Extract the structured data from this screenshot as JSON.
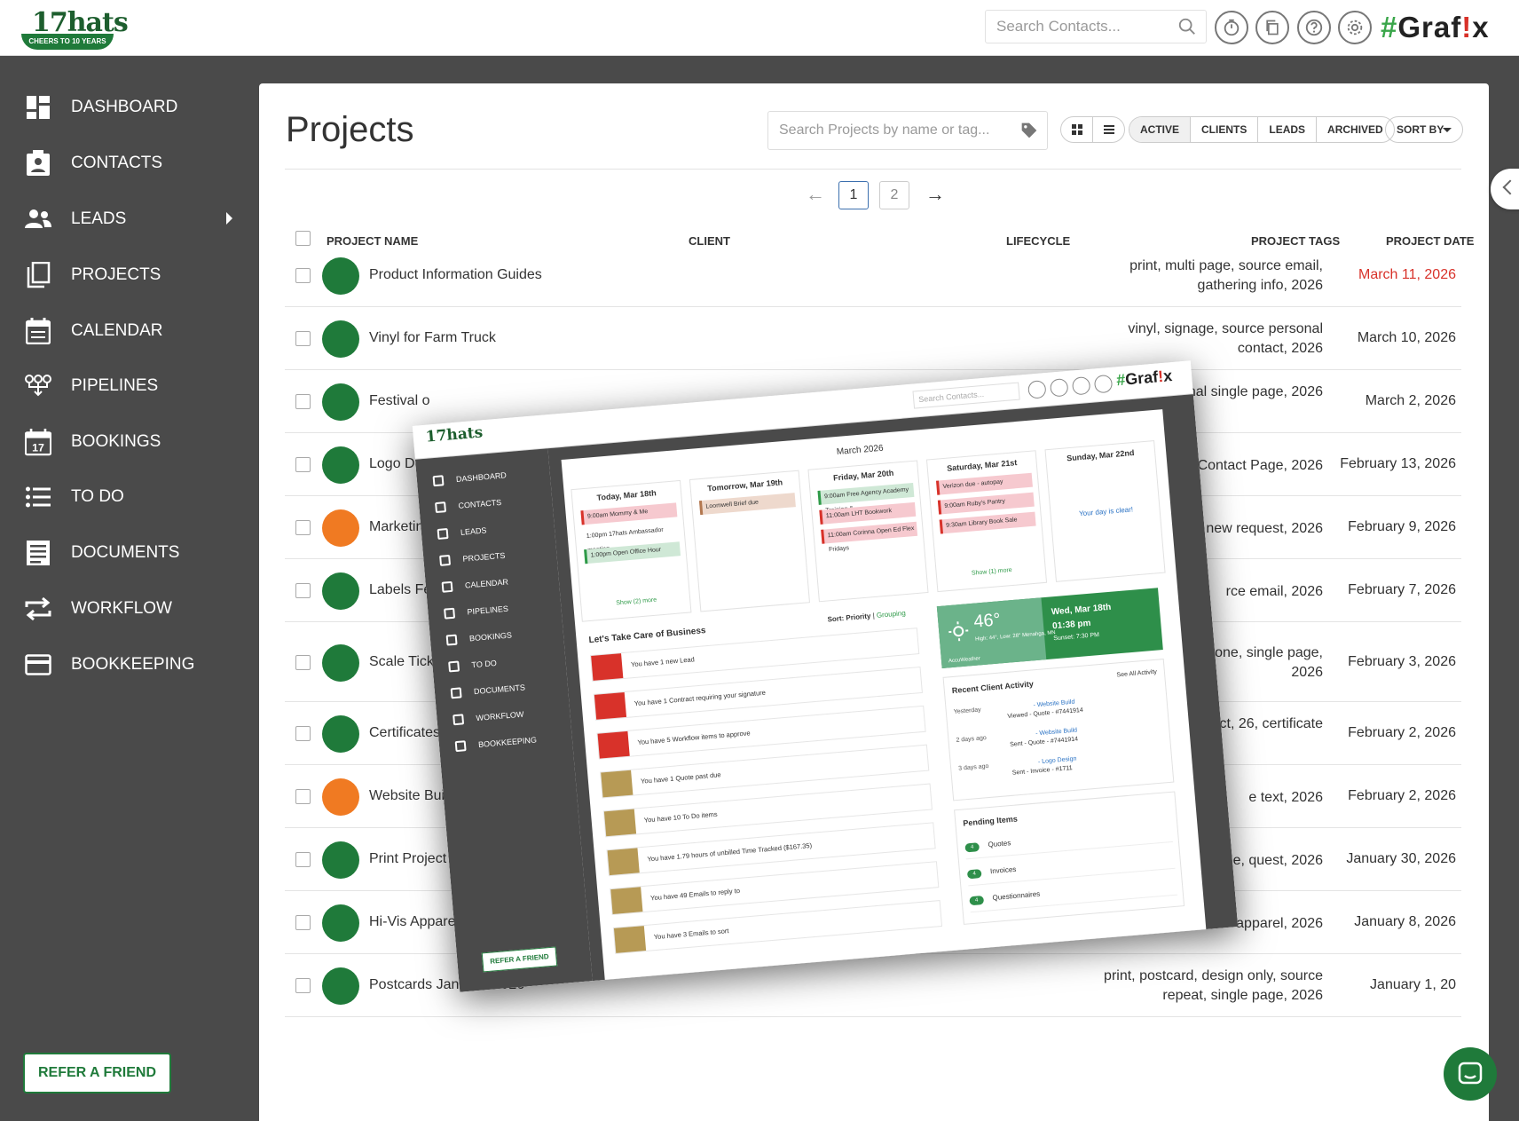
{
  "app": {
    "logo_text": "17hats",
    "logo_ribbon": "CHEERS TO 10 YEARS",
    "brand_hash": "#",
    "brand_a": "Graf",
    "brand_bang": "!",
    "brand_b": "x"
  },
  "topbar": {
    "search_placeholder": "Search Contacts..."
  },
  "sidebar": {
    "items": [
      {
        "label": "DASHBOARD",
        "icon": "dashboard-icon"
      },
      {
        "label": "CONTACTS",
        "icon": "contacts-icon"
      },
      {
        "label": "LEADS",
        "icon": "leads-icon"
      },
      {
        "label": "PROJECTS",
        "icon": "projects-icon"
      },
      {
        "label": "CALENDAR",
        "icon": "calendar-icon"
      },
      {
        "label": "PIPELINES",
        "icon": "pipelines-icon"
      },
      {
        "label": "BOOKINGS",
        "icon": "bookings-icon"
      },
      {
        "label": "TO DO",
        "icon": "todo-icon"
      },
      {
        "label": "DOCUMENTS",
        "icon": "documents-icon"
      },
      {
        "label": "WORKFLOW",
        "icon": "workflow-icon"
      },
      {
        "label": "BOOKKEEPING",
        "icon": "bookkeeping-icon"
      }
    ],
    "bookings_day": "17",
    "refer_label": "REFER A FRIEND"
  },
  "projects": {
    "title": "Projects",
    "search_placeholder": "Search Projects by name or tag...",
    "filters": [
      "ACTIVE",
      "CLIENTS",
      "LEADS",
      "ARCHIVED"
    ],
    "sort_label": "SORT BY",
    "pages": [
      "1",
      "2"
    ],
    "columns": [
      "PROJECT NAME",
      "CLIENT",
      "LIFECYCLE",
      "PROJECT TAGS",
      "PROJECT DATE"
    ],
    "rows": [
      {
        "name": "Product Information Guides",
        "tags": "print, multi page, source email, gathering info, 2026",
        "date": "March 11, 2026",
        "status": "green",
        "due": true
      },
      {
        "name": "Vinyl for Farm Truck",
        "tags": "vinyl, signage, source personal contact, 2026",
        "date": "March 10, 2026",
        "status": "green"
      },
      {
        "name": "Festival o",
        "tags": ", source personal single page, 2026",
        "date": "March 2, 2026",
        "status": "green"
      },
      {
        "name": "Logo Desi",
        "tags": "G Contact Page, 2026",
        "date": "February 13, 2026",
        "status": "green"
      },
      {
        "name": "Marketing",
        "tags": "ad new request, 2026",
        "date": "February 9, 2026",
        "status": "orange"
      },
      {
        "name": "Labels Feb 2",
        "tags": "rce email, 2026",
        "date": "February 7, 2026",
        "status": "green"
      },
      {
        "name": "Scale Ticket B",
        "tags": "ticket, repeat, phone, single page, 2026",
        "date": "February 3, 2026",
        "status": "green"
      },
      {
        "name": "Certificates",
        "tags": "onal contact, 26, certificate",
        "date": "February 2, 2026",
        "status": "green"
      },
      {
        "name": "Website Build",
        "tags": "e text, 2026",
        "date": "February 2, 2026",
        "status": "orange"
      },
      {
        "name": "Print Project",
        "tags": "urce phone, quest, 2026",
        "date": "January 30, 2026",
        "status": "green"
      },
      {
        "name": "Hi-Vis Apparel",
        "tags": "apparel, 2026",
        "date": "January 8, 2026",
        "status": "green"
      },
      {
        "name": "Postcards Jan-Dec 2026",
        "tags": "print, postcard, design only, source repeat, single page, 2026",
        "date": "January 1, 20",
        "status": "green"
      }
    ]
  },
  "colors": {
    "green": "#1f7a3a",
    "orange": "#f07a22",
    "due_red": "#d8322a"
  },
  "inset": {
    "search_placeholder": "Search Contacts...",
    "nav": [
      "DASHBOARD",
      "CONTACTS",
      "LEADS",
      "PROJECTS",
      "CALENDAR",
      "PIPELINES",
      "BOOKINGS",
      "TO DO",
      "DOCUMENTS",
      "WORKFLOW",
      "BOOKKEEPING"
    ],
    "refer_label": "REFER A FRIEND",
    "month": "March 2026",
    "days": [
      {
        "title": "Today, Mar 18th",
        "events": [
          {
            "text": "9:00am  Mommy & Me",
            "kind": "pink"
          },
          {
            "text": "1:00pm  17hats Ambassador meeting",
            "kind": "plain"
          },
          {
            "text": "1:00pm  Open Office Hour",
            "kind": "green"
          }
        ],
        "more": "Show (2) more"
      },
      {
        "title": "Tomorrow, Mar 19th",
        "events": [
          {
            "text": "Loomwell Brief due",
            "kind": "tan"
          }
        ],
        "more": ""
      },
      {
        "title": "Friday, Mar 20th",
        "events": [
          {
            "text": "9:00am  Free Agency Academy Training &",
            "kind": "green"
          },
          {
            "text": "11:00am  LHT Bookwork",
            "kind": "pink"
          },
          {
            "text": "11:00am  Corinna Open Ed Flex Fridays",
            "kind": "pink"
          }
        ],
        "more": ""
      },
      {
        "title": "Saturday, Mar 21st",
        "events": [
          {
            "text": "Verizon due - autopay",
            "kind": "pink"
          },
          {
            "text": "9:00am  Ruby's Pantry",
            "kind": "pink"
          },
          {
            "text": "9:30am  Library Book Sale",
            "kind": "pink"
          }
        ],
        "more": "Show (1) more"
      },
      {
        "title": "Sunday, Mar 22nd",
        "events": [],
        "more": "",
        "clear": "Your day is clear!"
      }
    ],
    "business_title": "Let's Take Care of Business",
    "sort_label": "Sort: Priority",
    "sort_alt": "Grouping",
    "tasks": [
      {
        "text": "You have 1 new Lead",
        "color": "#d8322a"
      },
      {
        "text": "You have 1 Contract requiring your signature",
        "color": "#d8322a"
      },
      {
        "text": "You have 5 Workflow items to approve",
        "color": "#d8322a"
      },
      {
        "text": "You have 1 Quote past due",
        "color": "#b79a55"
      },
      {
        "text": "You have 10 To Do items",
        "color": "#b79a55"
      },
      {
        "text": "You have 1.79 hours of unbilled Time Tracked ($167.35)",
        "color": "#b79a55"
      },
      {
        "text": "You have 49 Emails to reply to",
        "color": "#b79a55"
      },
      {
        "text": "You have 3 Emails to sort",
        "color": "#b79a55"
      }
    ],
    "weather": {
      "temp": "46°",
      "detail": "High: 44°, Low: 28°  Menahga, MN",
      "date": "Wed, Mar 18th",
      "time": "01:38 pm",
      "sunset": "Sunset: 7:30 PM",
      "credit": "AccuWeather"
    },
    "activity_title": "Recent Client Activity",
    "activity_see": "See All Activity",
    "activity": [
      {
        "when": "Yesterday",
        "link": "- Website Build",
        "desc": "Viewed - Quote - #7441914"
      },
      {
        "when": "2 days ago",
        "link": "- Website Build",
        "desc": "Sent - Quote - #7441914"
      },
      {
        "when": "3 days ago",
        "link": "- Logo Design",
        "desc": "Sent - Invoice - #1711"
      }
    ],
    "pending_title": "Pending Items",
    "pending": [
      {
        "count": "4",
        "label": "Quotes"
      },
      {
        "count": "4",
        "label": "Invoices"
      },
      {
        "count": "4",
        "label": "Questionnaires"
      }
    ]
  }
}
